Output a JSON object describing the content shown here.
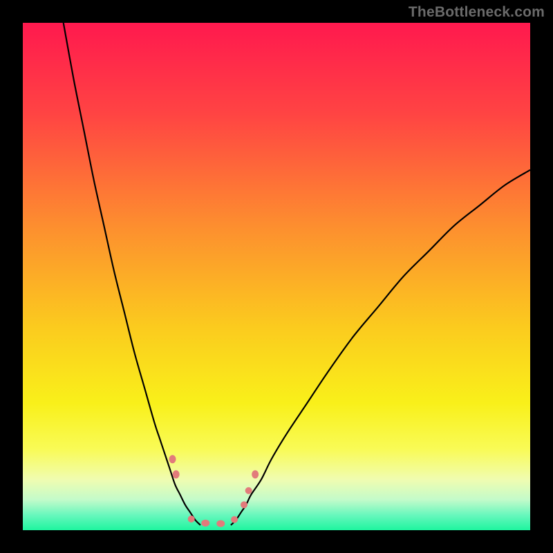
{
  "watermark": "TheBottleneck.com",
  "gradient_stops": [
    {
      "pct": 0,
      "color": "#ff194e"
    },
    {
      "pct": 18,
      "color": "#ff4443"
    },
    {
      "pct": 40,
      "color": "#fd8e2f"
    },
    {
      "pct": 60,
      "color": "#fbcb1e"
    },
    {
      "pct": 75,
      "color": "#f9f01a"
    },
    {
      "pct": 84,
      "color": "#f9fb56"
    },
    {
      "pct": 90,
      "color": "#f0fcb0"
    },
    {
      "pct": 94,
      "color": "#c3fbca"
    },
    {
      "pct": 97,
      "color": "#68f7bd"
    },
    {
      "pct": 100,
      "color": "#1ef59f"
    }
  ],
  "chart_data": {
    "type": "line",
    "title": "",
    "xlabel": "",
    "ylabel": "",
    "xlim": [
      0,
      100
    ],
    "ylim": [
      0,
      100
    ],
    "series": [
      {
        "name": "left-curve",
        "x": [
          8,
          10,
          12,
          14,
          16,
          18,
          20,
          22,
          24,
          26,
          27,
          28,
          29,
          30,
          31,
          32,
          33,
          34,
          35
        ],
        "values": [
          100,
          89,
          79,
          69,
          60,
          51,
          43,
          35,
          28,
          21,
          18,
          15,
          12,
          9,
          7,
          5,
          3.5,
          2,
          1
        ]
      },
      {
        "name": "right-curve",
        "x": [
          41,
          42,
          43,
          44,
          45,
          47,
          49,
          52,
          56,
          60,
          65,
          70,
          75,
          80,
          85,
          90,
          95,
          100
        ],
        "values": [
          1,
          2,
          3.5,
          5,
          7,
          10,
          14,
          19,
          25,
          31,
          38,
          44,
          50,
          55,
          60,
          64,
          68,
          71
        ]
      }
    ],
    "markers": [
      {
        "x": 29.5,
        "y": 14,
        "rx": 5,
        "ry": 6
      },
      {
        "x": 30.2,
        "y": 11,
        "rx": 5,
        "ry": 6
      },
      {
        "x": 33.2,
        "y": 2.2,
        "rx": 5,
        "ry": 5
      },
      {
        "x": 36,
        "y": 1.4,
        "rx": 6,
        "ry": 5
      },
      {
        "x": 39,
        "y": 1.3,
        "rx": 6,
        "ry": 5
      },
      {
        "x": 41.7,
        "y": 2.1,
        "rx": 5,
        "ry": 5
      },
      {
        "x": 43.6,
        "y": 5,
        "rx": 5,
        "ry": 5
      },
      {
        "x": 44.5,
        "y": 7.8,
        "rx": 5,
        "ry": 5
      },
      {
        "x": 45.8,
        "y": 11,
        "rx": 5,
        "ry": 6
      }
    ],
    "marker_fill": "#e27b7b"
  }
}
